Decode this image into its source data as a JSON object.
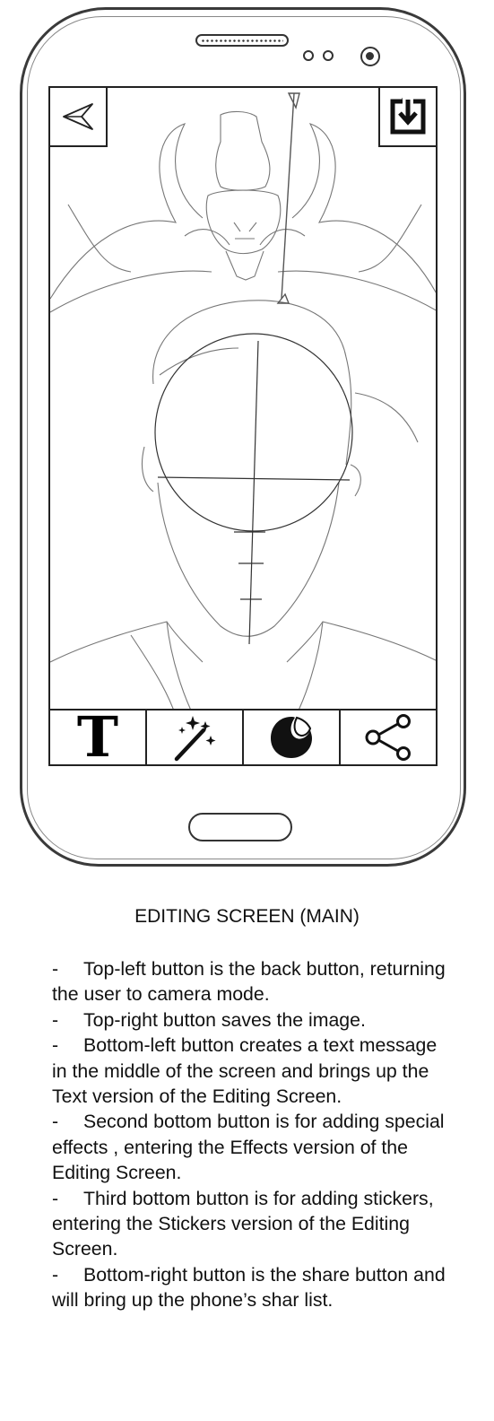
{
  "screen": {
    "back_button": {
      "icon": "send-arrow-icon"
    },
    "save_button": {
      "icon": "save-download-icon"
    },
    "toolbar": [
      {
        "id": "text",
        "icon": "text-icon",
        "glyph": "T"
      },
      {
        "id": "effects",
        "icon": "magic-wand-icon"
      },
      {
        "id": "stickers",
        "icon": "sticker-icon"
      },
      {
        "id": "share",
        "icon": "share-icon"
      }
    ]
  },
  "caption": "EDITING SCREEN (MAIN)",
  "notes": [
    {
      "dash": "-",
      "text": "Top-left button is the back button, returning the user to camera mode."
    },
    {
      "dash": "-",
      "text": "Top-right button saves the image."
    },
    {
      "dash": "-",
      "text": "Bottom-left button creates a text message in the middle of the screen and brings up the Text version of the Editing Screen."
    },
    {
      "dash": "-",
      "text": "Second bottom button is for adding special effects , entering the Effects version of the Editing Screen."
    },
    {
      "dash": "-",
      "text": "Third bottom button is for adding stickers, entering the Stickers version of the Editing Screen."
    },
    {
      "dash": "-",
      "text": "Bottom-right button is the share button and will bring up the phone’s shar list."
    }
  ]
}
